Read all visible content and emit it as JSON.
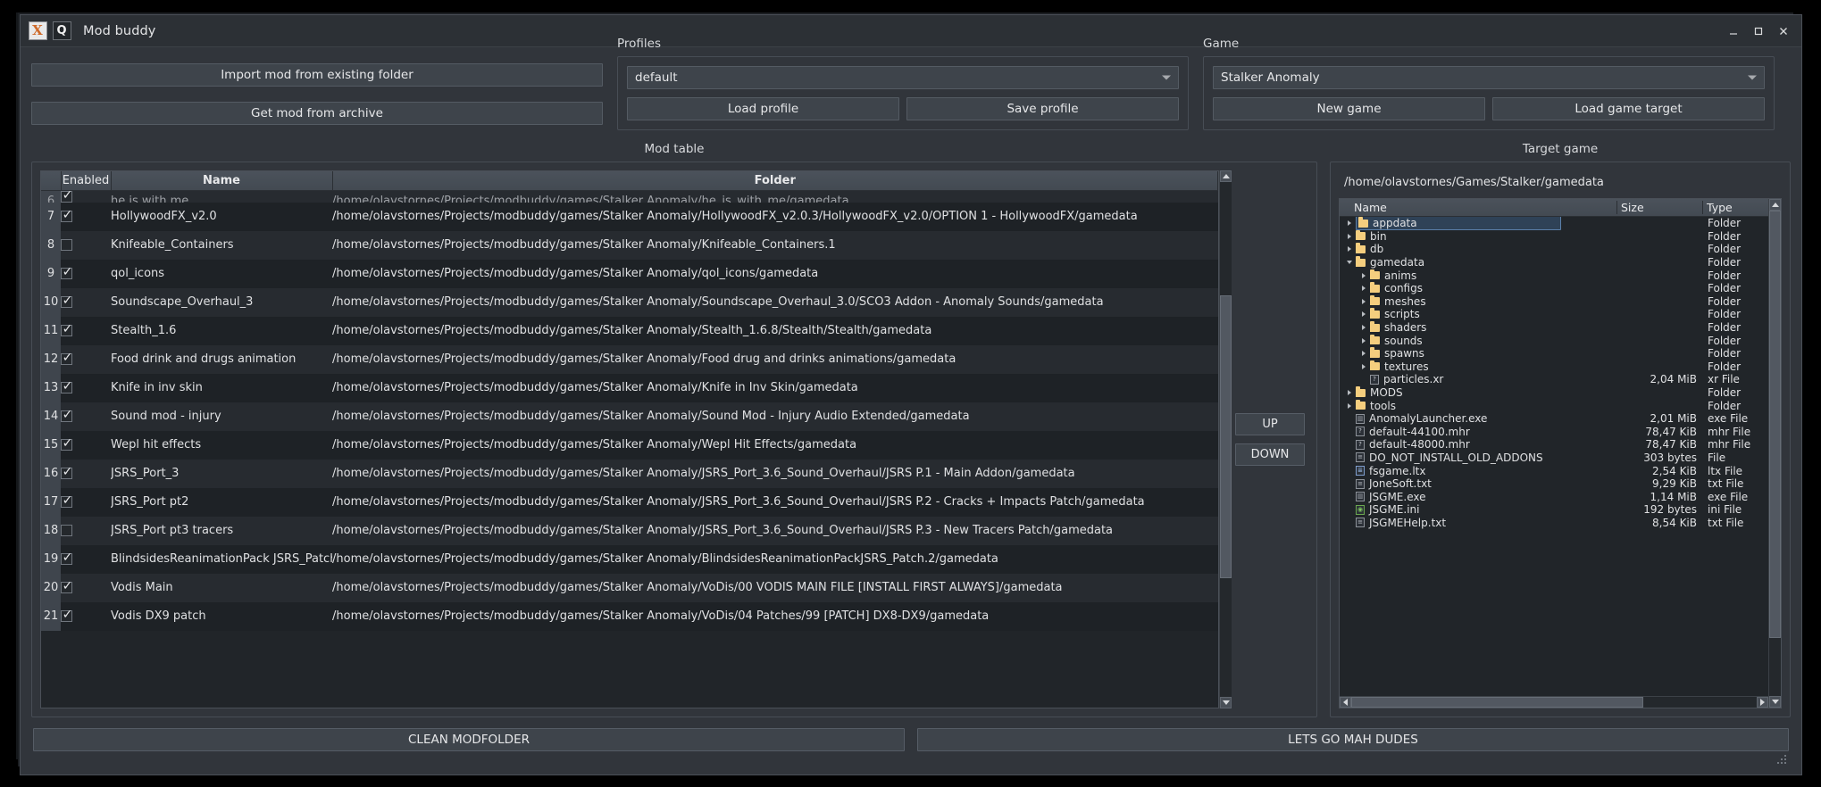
{
  "window": {
    "title": "Mod buddy",
    "icon_left": "application-icon",
    "icon_right": "qt-icon",
    "minimize": "minimize-icon",
    "maximize": "maximize-icon",
    "close": "close-icon"
  },
  "actions": {
    "import_mod": "Import mod from existing folder",
    "get_mod": "Get mod from archive"
  },
  "profiles": {
    "title": "Profiles",
    "selected": "default",
    "load": "Load profile",
    "save": "Save profile"
  },
  "game": {
    "title": "Game",
    "selected": "Stalker Anomaly",
    "new_game": "New game",
    "load_target": "Load game target"
  },
  "mod_table": {
    "title": "Mod table",
    "columns": [
      "",
      "Enabled",
      "Name",
      "Folder"
    ],
    "move_up": "UP",
    "move_down": "DOWN",
    "rows": [
      {
        "idx": "6",
        "enabled": true,
        "name": "he is with me",
        "folder": "/home/olavstornes/Projects/modbuddy/games/Stalker Anomaly/he_is_with_me/gamedata"
      },
      {
        "idx": "7",
        "enabled": true,
        "name": "HollywoodFX_v2.0",
        "folder": "/home/olavstornes/Projects/modbuddy/games/Stalker Anomaly/HollywoodFX_v2.0.3/HollywoodFX_v2.0/OPTION 1 - HollywoodFX/gamedata"
      },
      {
        "idx": "8",
        "enabled": false,
        "name": "Knifeable_Containers",
        "folder": "/home/olavstornes/Projects/modbuddy/games/Stalker Anomaly/Knifeable_Containers.1"
      },
      {
        "idx": "9",
        "enabled": true,
        "name": "qol_icons",
        "folder": "/home/olavstornes/Projects/modbuddy/games/Stalker Anomaly/qol_icons/gamedata"
      },
      {
        "idx": "10",
        "enabled": true,
        "name": "Soundscape_Overhaul_3",
        "folder": "/home/olavstornes/Projects/modbuddy/games/Stalker Anomaly/Soundscape_Overhaul_3.0/SCO3 Addon - Anomaly Sounds/gamedata"
      },
      {
        "idx": "11",
        "enabled": true,
        "name": "Stealth_1.6",
        "folder": "/home/olavstornes/Projects/modbuddy/games/Stalker Anomaly/Stealth_1.6.8/Stealth/Stealth/gamedata"
      },
      {
        "idx": "12",
        "enabled": true,
        "name": "Food drink and drugs animation",
        "folder": "/home/olavstornes/Projects/modbuddy/games/Stalker Anomaly/Food drug and drinks animations/gamedata"
      },
      {
        "idx": "13",
        "enabled": true,
        "name": "Knife in inv skin",
        "folder": "/home/olavstornes/Projects/modbuddy/games/Stalker Anomaly/Knife in Inv Skin/gamedata"
      },
      {
        "idx": "14",
        "enabled": true,
        "name": "Sound mod - injury",
        "folder": "/home/olavstornes/Projects/modbuddy/games/Stalker Anomaly/Sound Mod - Injury Audio Extended/gamedata"
      },
      {
        "idx": "15",
        "enabled": true,
        "name": "Wepl hit effects",
        "folder": "/home/olavstornes/Projects/modbuddy/games/Stalker Anomaly/Wepl Hit Effects/gamedata"
      },
      {
        "idx": "16",
        "enabled": true,
        "name": "JSRS_Port_3",
        "folder": "/home/olavstornes/Projects/modbuddy/games/Stalker Anomaly/JSRS_Port_3.6_Sound_Overhaul/JSRS P.1 - Main Addon/gamedata"
      },
      {
        "idx": "17",
        "enabled": true,
        "name": "JSRS_Port pt2",
        "folder": "/home/olavstornes/Projects/modbuddy/games/Stalker Anomaly/JSRS_Port_3.6_Sound_Overhaul/JSRS P.2 - Cracks + Impacts Patch/gamedata"
      },
      {
        "idx": "18",
        "enabled": false,
        "name": "JSRS_Port pt3 tracers",
        "folder": "/home/olavstornes/Projects/modbuddy/games/Stalker Anomaly/JSRS_Port_3.6_Sound_Overhaul/JSRS P.3 - New Tracers Patch/gamedata"
      },
      {
        "idx": "19",
        "enabled": true,
        "name": "BlindsidesReanimationPack JSRS_Patch",
        "folder": "/home/olavstornes/Projects/modbuddy/games/Stalker Anomaly/BlindsidesReanimationPackJSRS_Patch.2/gamedata"
      },
      {
        "idx": "20",
        "enabled": true,
        "name": "Vodis Main",
        "folder": "/home/olavstornes/Projects/modbuddy/games/Stalker Anomaly/VoDis/00 VODIS MAIN FILE [INSTALL FIRST ALWAYS]/gamedata"
      },
      {
        "idx": "21",
        "enabled": true,
        "name": "Vodis DX9 patch",
        "folder": "/home/olavstornes/Projects/modbuddy/games/Stalker Anomaly/VoDis/04 Patches/99 [PATCH] DX8-DX9/gamedata"
      }
    ]
  },
  "target_game": {
    "title": "Target game",
    "path": "/home/olavstornes/Games/Stalker/gamedata",
    "columns": [
      "Name",
      "Size",
      "Type"
    ],
    "rows": [
      {
        "name": "appdata",
        "size": "",
        "type": "Folder",
        "depth": 0,
        "kind": "folder",
        "twist": "collapsed",
        "selected": true
      },
      {
        "name": "bin",
        "size": "",
        "type": "Folder",
        "depth": 0,
        "kind": "folder",
        "twist": "collapsed",
        "selected": false
      },
      {
        "name": "db",
        "size": "",
        "type": "Folder",
        "depth": 0,
        "kind": "folder",
        "twist": "collapsed",
        "selected": false
      },
      {
        "name": "gamedata",
        "size": "",
        "type": "Folder",
        "depth": 0,
        "kind": "folder",
        "twist": "expanded",
        "selected": false
      },
      {
        "name": "anims",
        "size": "",
        "type": "Folder",
        "depth": 1,
        "kind": "folder",
        "twist": "collapsed",
        "selected": false
      },
      {
        "name": "configs",
        "size": "",
        "type": "Folder",
        "depth": 1,
        "kind": "folder",
        "twist": "collapsed",
        "selected": false
      },
      {
        "name": "meshes",
        "size": "",
        "type": "Folder",
        "depth": 1,
        "kind": "folder",
        "twist": "collapsed",
        "selected": false
      },
      {
        "name": "scripts",
        "size": "",
        "type": "Folder",
        "depth": 1,
        "kind": "folder",
        "twist": "collapsed",
        "selected": false
      },
      {
        "name": "shaders",
        "size": "",
        "type": "Folder",
        "depth": 1,
        "kind": "folder",
        "twist": "collapsed",
        "selected": false
      },
      {
        "name": "sounds",
        "size": "",
        "type": "Folder",
        "depth": 1,
        "kind": "folder",
        "twist": "collapsed",
        "selected": false
      },
      {
        "name": "spawns",
        "size": "",
        "type": "Folder",
        "depth": 1,
        "kind": "folder",
        "twist": "collapsed",
        "selected": false
      },
      {
        "name": "textures",
        "size": "",
        "type": "Folder",
        "depth": 1,
        "kind": "folder",
        "twist": "collapsed",
        "selected": false
      },
      {
        "name": "particles.xr",
        "size": "2,04 MiB",
        "type": "xr File",
        "depth": 1,
        "kind": "file-q",
        "twist": "none",
        "selected": false
      },
      {
        "name": "MODS",
        "size": "",
        "type": "Folder",
        "depth": 0,
        "kind": "folder",
        "twist": "collapsed",
        "selected": false
      },
      {
        "name": "tools",
        "size": "",
        "type": "Folder",
        "depth": 0,
        "kind": "folder",
        "twist": "collapsed",
        "selected": false
      },
      {
        "name": "AnomalyLauncher.exe",
        "size": "2,01 MiB",
        "type": "exe File",
        "depth": 0,
        "kind": "file-exe",
        "twist": "none",
        "selected": false
      },
      {
        "name": "default-44100.mhr",
        "size": "78,47 KiB",
        "type": "mhr File",
        "depth": 0,
        "kind": "file-q",
        "twist": "none",
        "selected": false
      },
      {
        "name": "default-48000.mhr",
        "size": "78,47 KiB",
        "type": "mhr File",
        "depth": 0,
        "kind": "file-q",
        "twist": "none",
        "selected": false
      },
      {
        "name": "DO_NOT_INSTALL_OLD_ADDONS",
        "size": "303 bytes",
        "type": "File",
        "depth": 0,
        "kind": "file-doc",
        "twist": "none",
        "selected": false
      },
      {
        "name": "fsgame.ltx",
        "size": "2,54 KiB",
        "type": "ltx File",
        "depth": 0,
        "kind": "file-ltx",
        "twist": "none",
        "selected": false
      },
      {
        "name": "JoneSoft.txt",
        "size": "9,29 KiB",
        "type": "txt File",
        "depth": 0,
        "kind": "file-txt",
        "twist": "none",
        "selected": false
      },
      {
        "name": "JSGME.exe",
        "size": "1,14 MiB",
        "type": "exe File",
        "depth": 0,
        "kind": "file-exe",
        "twist": "none",
        "selected": false
      },
      {
        "name": "JSGME.ini",
        "size": "192 bytes",
        "type": "ini File",
        "depth": 0,
        "kind": "file-ini",
        "twist": "none",
        "selected": false
      },
      {
        "name": "JSGMEHelp.txt",
        "size": "8,54 KiB",
        "type": "txt File",
        "depth": 0,
        "kind": "file-txt",
        "twist": "none",
        "selected": false
      }
    ]
  },
  "bottom": {
    "clean": "CLEAN MODFOLDER",
    "go": "LETS GO MAH DUDES"
  },
  "colors": {
    "window_bg": "#31353b",
    "panel_bg": "#212529",
    "accent_select": "#2f4257",
    "folder_icon": "#f5ce7e"
  }
}
